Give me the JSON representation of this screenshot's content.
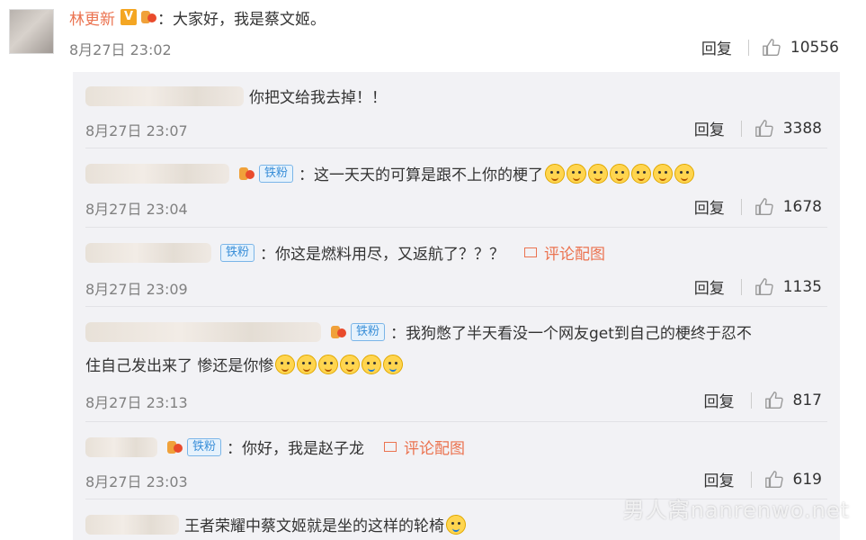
{
  "post": {
    "author": "林更新",
    "verified_badge": "V",
    "separator": "：",
    "text": "大家好，我是蔡文姬。",
    "time": "8月27日 23:02",
    "reply_label": "回复",
    "likes": "10556"
  },
  "replies": [
    {
      "text": "你把文给我去掉！！",
      "time": "8月27日 23:07",
      "reply_label": "回复",
      "likes": "3388"
    },
    {
      "badge": "铁粉",
      "separator": "：",
      "text": "这一天天的可算是跟不上你的梗了",
      "emoji_count": 7,
      "time": "8月27日 23:04",
      "reply_label": "回复",
      "likes": "1678"
    },
    {
      "badge": "铁粉",
      "separator": "：",
      "text": "你这是燃料用尽，又返航了？？？",
      "image_link": "评论配图",
      "time": "8月27日 23:09",
      "reply_label": "回复",
      "likes": "1135"
    },
    {
      "badge": "铁粉",
      "separator": "：",
      "text_line1": "我狗憋了半天看没一个网友get到自己的梗终于忍不",
      "text_line2": "住自己发出来了 惨还是你惨",
      "time": "8月27日 23:13",
      "reply_label": "回复",
      "likes": "817"
    },
    {
      "badge": "铁粉",
      "separator": "：",
      "text": "你好，我是赵子龙",
      "image_link": "评论配图",
      "time": "8月27日 23:03",
      "reply_label": "回复",
      "likes": "619"
    },
    {
      "text": "王者荣耀中蔡文姬就是坐的这样的轮椅"
    }
  ],
  "watermark": "男人窝nanrenwo.net",
  "colors": {
    "author": "#eb7350",
    "meta": "#808080",
    "reply_bg": "#f2f2f5",
    "fan_badge": "#3a8fd8"
  }
}
